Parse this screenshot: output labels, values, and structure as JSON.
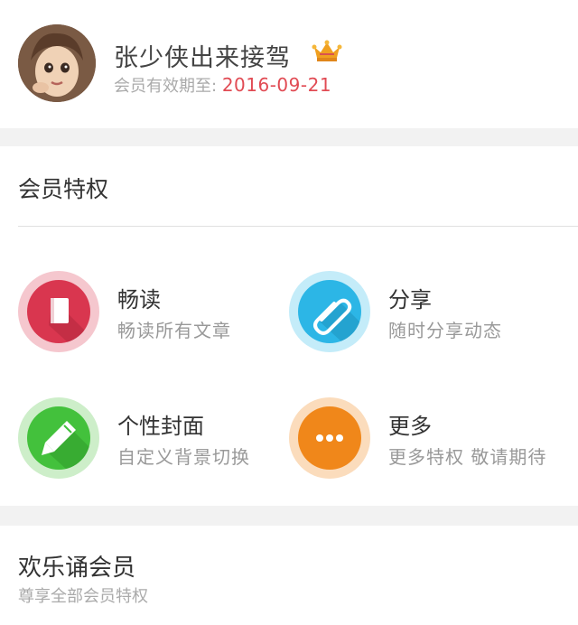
{
  "profile": {
    "name": "张少侠出来接驾",
    "validity_label": "会员有效期至:",
    "validity_date": "2016-09-21"
  },
  "privileges": {
    "title": "会员特权",
    "items": [
      {
        "title": "畅读",
        "desc": "畅读所有文章",
        "icon": "book-icon",
        "color": "#d9364f",
        "ring": "#f5c7ce"
      },
      {
        "title": "分享",
        "desc": "随时分享动态",
        "icon": "paperclip-icon",
        "color": "#2cb6e6",
        "ring": "#c4ecf9"
      },
      {
        "title": "个性封面",
        "desc": "自定义背景切换",
        "icon": "pencil-icon",
        "color": "#43c13c",
        "ring": "#cdeec9"
      },
      {
        "title": "更多",
        "desc": "更多特权  敬请期待",
        "icon": "more-dots-icon",
        "color": "#f0871a",
        "ring": "#fbdcbc"
      }
    ]
  },
  "membership": {
    "title": "欢乐诵会员",
    "subtitle": "尊享全部会员特权"
  },
  "colors": {
    "accent_date": "#e14b54",
    "crown": "#f0a020"
  }
}
